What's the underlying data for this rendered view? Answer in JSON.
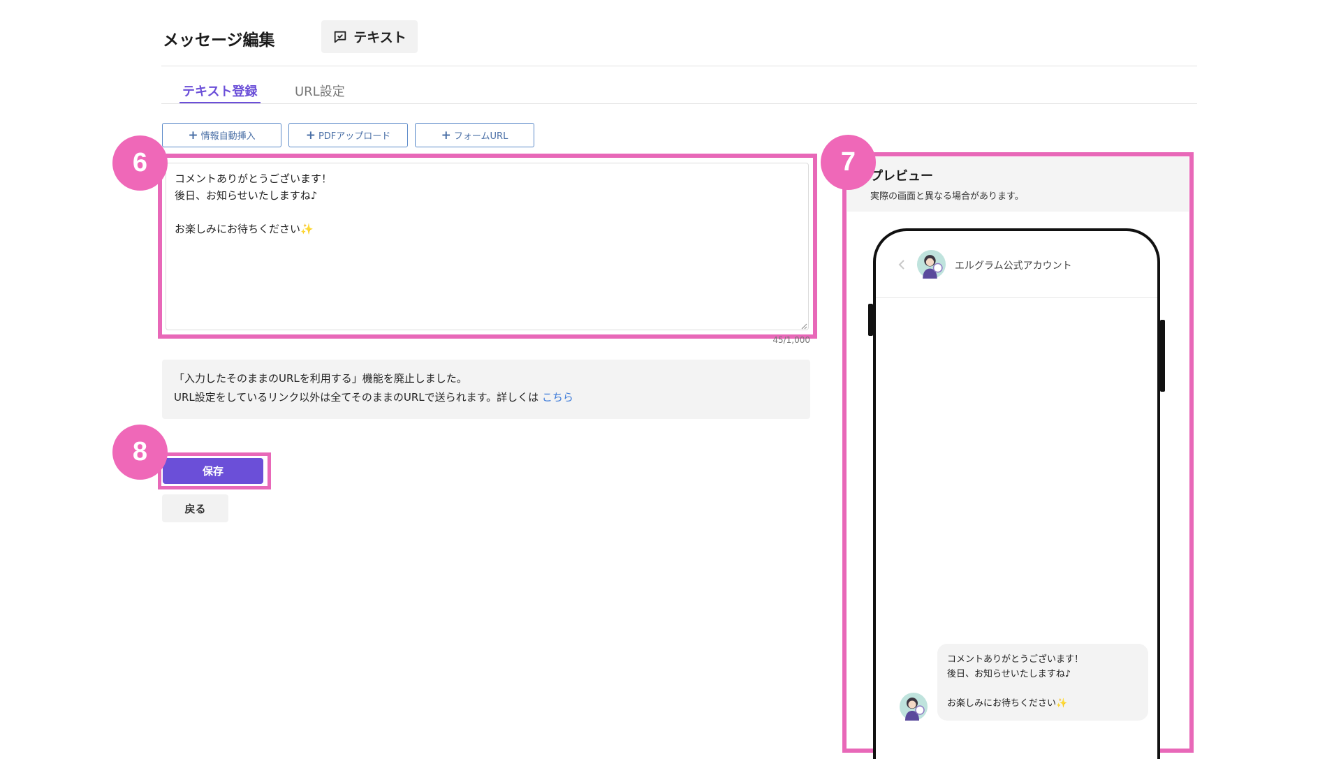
{
  "header": {
    "title": "メッセージ編集",
    "type_chip_label": "テキスト",
    "type_chip_icon": "chat-bubble-icon"
  },
  "tabs": [
    {
      "label": "テキスト登録",
      "active": true
    },
    {
      "label": "URL設定",
      "active": false
    }
  ],
  "insert_buttons": [
    {
      "label": "情報自動挿入",
      "icon": "plus-icon"
    },
    {
      "label": "PDFアップロード",
      "icon": "plus-icon"
    },
    {
      "label": "フォームURL",
      "icon": "plus-icon"
    }
  ],
  "editor": {
    "lines": [
      "コメントありがとうございます！",
      "後日、お知らせいたしますね♪",
      "",
      "お楽しみにお待ちください✨"
    ],
    "counter": "45/1,000"
  },
  "notice": {
    "line1": "「入力したそのままのURLを利用する」機能を廃止しました。",
    "line2": "URL設定をしているリンク以外は全てそのままのURLで送られます。詳しくは",
    "link": "こちら"
  },
  "actions": {
    "save": "保存",
    "back": "戻る"
  },
  "badges": {
    "editor": "6",
    "preview": "7",
    "save": "8"
  },
  "preview": {
    "title": "プレビュー",
    "subtitle": "実際の画面と異なる場合があります。",
    "account_name": "エルグラム公式アカウント",
    "message_lines": [
      "コメントありがとうございます！",
      "後日、お知らせいたしますね♪",
      "",
      "お楽しみにお待ちください✨"
    ]
  },
  "colors": {
    "accent": "#6b4fd8",
    "highlight": "#e868b8",
    "badge": "#ef68b8",
    "link": "#3d7bd9"
  }
}
